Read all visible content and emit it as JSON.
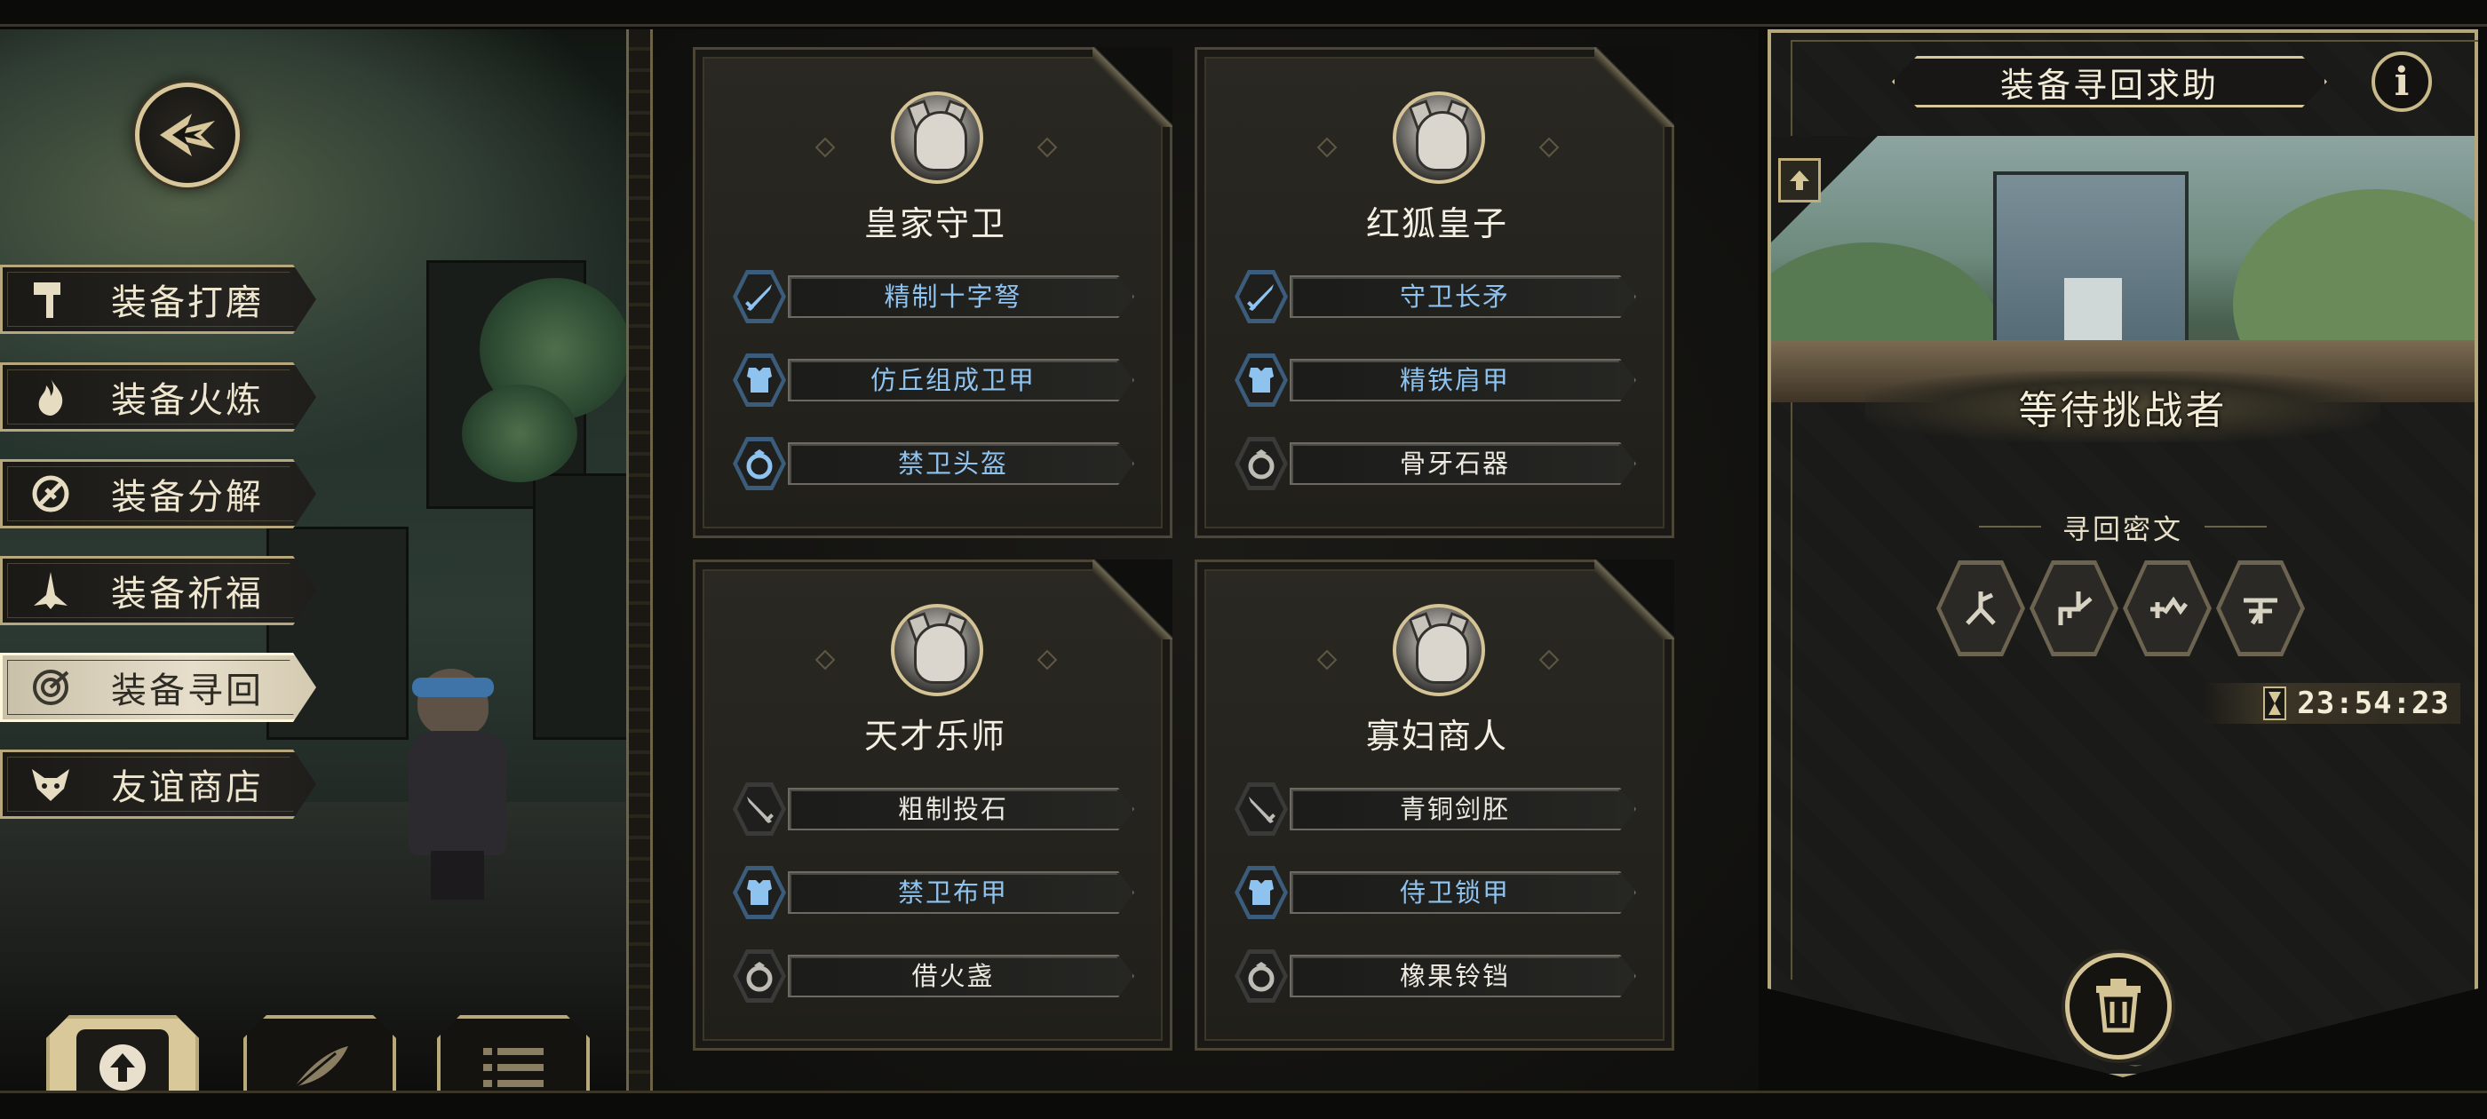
{
  "menu": {
    "items": [
      {
        "label": "装备打磨",
        "icon": "hammer-icon",
        "active": false
      },
      {
        "label": "装备火炼",
        "icon": "flame-icon",
        "active": false
      },
      {
        "label": "装备分解",
        "icon": "disassemble-icon",
        "active": false
      },
      {
        "label": "装备祈福",
        "icon": "pray-icon",
        "active": false
      },
      {
        "label": "装备寻回",
        "icon": "target-icon",
        "active": true
      },
      {
        "label": "友谊商店",
        "icon": "fox-icon",
        "active": false
      }
    ]
  },
  "bottom_buttons": [
    {
      "icon": "upload-icon",
      "active": true
    },
    {
      "icon": "feather-icon",
      "active": false
    },
    {
      "icon": "list-icon",
      "active": false
    }
  ],
  "bosses": [
    {
      "name": "皇家守卫",
      "equipment": [
        {
          "slot": "weapon",
          "name": "精制十字弩",
          "color": "blue"
        },
        {
          "slot": "armor",
          "name": "仿丘组成卫甲",
          "color": "blue"
        },
        {
          "slot": "ring",
          "name": "禁卫头盔",
          "color": "blue"
        }
      ]
    },
    {
      "name": "红狐皇子",
      "equipment": [
        {
          "slot": "weapon",
          "name": "守卫长矛",
          "color": "blue"
        },
        {
          "slot": "armor",
          "name": "精铁肩甲",
          "color": "blue"
        },
        {
          "slot": "ring",
          "name": "骨牙石器",
          "color": "white"
        }
      ]
    },
    {
      "name": "天才乐师",
      "equipment": [
        {
          "slot": "weapon",
          "name": "粗制投石",
          "color": "white"
        },
        {
          "slot": "armor",
          "name": "禁卫布甲",
          "color": "blue"
        },
        {
          "slot": "ring",
          "name": "借火盏",
          "color": "white"
        }
      ]
    },
    {
      "name": "寡妇商人",
      "equipment": [
        {
          "slot": "weapon",
          "name": "青铜剑胚",
          "color": "white"
        },
        {
          "slot": "armor",
          "name": "侍卫锁甲",
          "color": "blue"
        },
        {
          "slot": "ring",
          "name": "橡果铃铛",
          "color": "white"
        }
      ]
    }
  ],
  "right_panel": {
    "title": "装备寻回求助",
    "info_label": "i",
    "status": "等待挑战者",
    "rune_label": "寻回密文",
    "runes": [
      "rune-1-icon",
      "rune-2-icon",
      "rune-3-icon",
      "rune-4-icon"
    ],
    "timer": "23:54:23"
  },
  "colors": {
    "gold_border": "#b6a77d",
    "blue_item": "#8fc3ef",
    "white_item": "#ece9e0",
    "active_menu_bg": "#e6decb"
  }
}
